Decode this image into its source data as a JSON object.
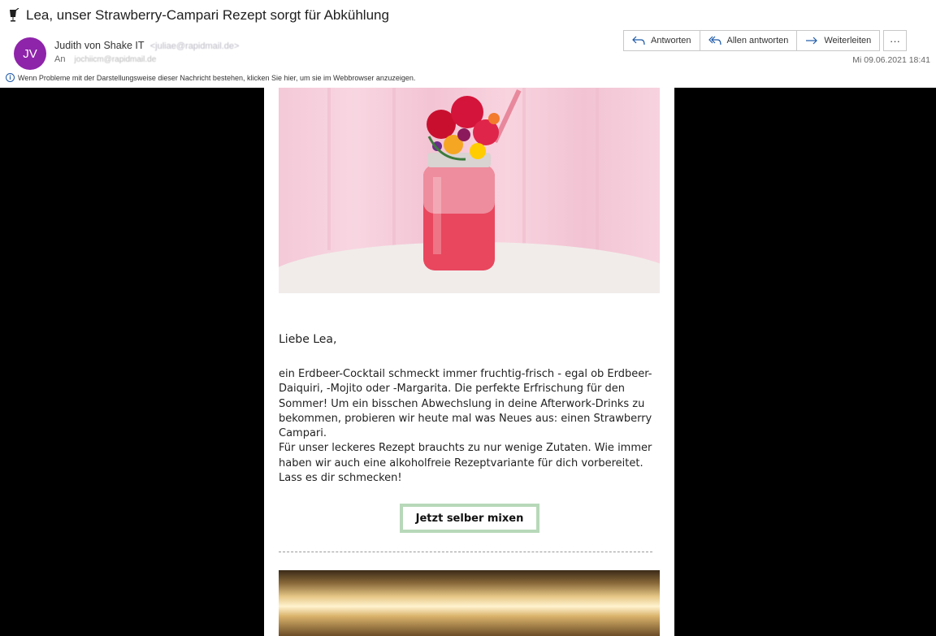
{
  "header": {
    "subject": "Lea, unser Strawberry-Campari Rezept sorgt für Abkühlung",
    "avatar_initials": "JV",
    "avatar_color": "#8e24aa",
    "sender_name": "Judith von Shake IT",
    "sender_email": "<juliae@rapidmail.de>",
    "to_label": "An",
    "to_address": "jochiicm@rapidmail.de",
    "date": "Mi 09.06.2021 18:41",
    "actions": {
      "reply": "Antworten",
      "reply_all": "Allen antworten",
      "forward": "Weiterleiten",
      "more": "···"
    },
    "info_text": "Wenn Probleme mit der Darstellungsweise dieser Nachricht bestehen, klicken Sie hier, um sie im Webbrowser anzuzeigen."
  },
  "email": {
    "greeting": "Liebe Lea,",
    "paragraph_1": "ein Erdbeer-Cocktail schmeckt immer fruchtig-frisch - egal ob Erdbeer-Daiquiri, -Mojito oder -Margarita. Die perfekte Erfrischung für den Sommer! Um ein bisschen Abwechslung in deine Afterwork-Drinks zu bekommen, probieren wir heute mal was Neues aus: einen Strawberry Campari.",
    "paragraph_2": "Für unser leckeres Rezept brauchts zu nur wenige Zutaten. Wie immer haben wir auch eine alkoholfreie Rezeptvariante für dich vorbereitet. Lass es dir schmecken!",
    "cta_label": "Jetzt selber mixen"
  },
  "colors": {
    "accent_blue": "#1e5aa8",
    "cta_border": "#b7d8b9",
    "backdrop": "#000000"
  }
}
